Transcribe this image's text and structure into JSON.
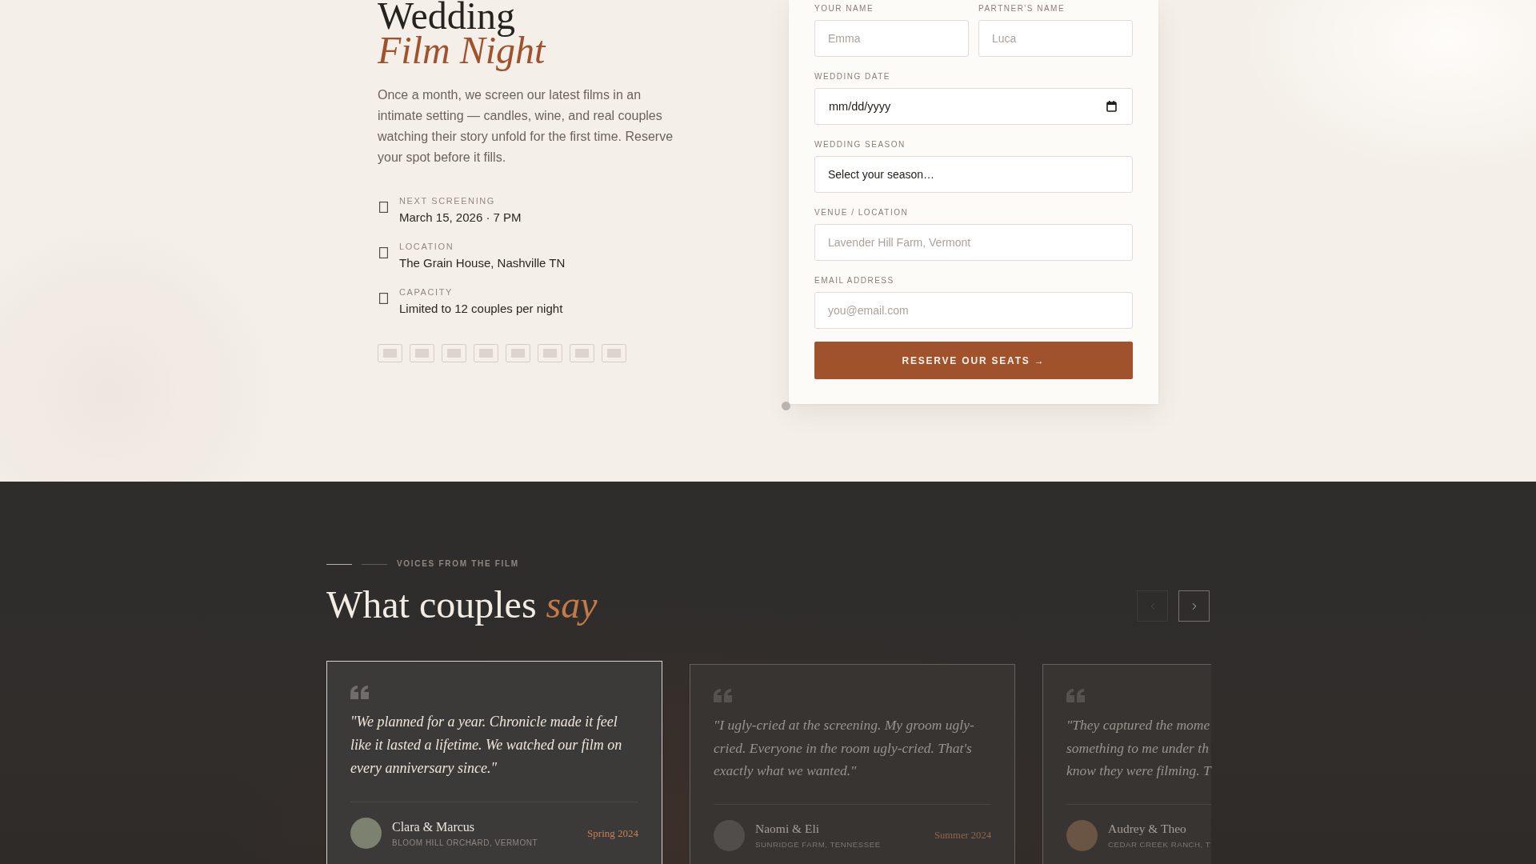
{
  "hero": {
    "title": "Wedding *Film Night*",
    "description": "Once a month, we screen our latest films in an intimate setting — candles, wine, and real couples watching their story unfold for the first time. Reserve your spot before it fills.",
    "details": [
      {
        "label": "NEXT SCREENING",
        "value": "March 15, 2026 · 7 PM"
      },
      {
        "label": "LOCATION",
        "value": "The Grain House, Nashville TN"
      },
      {
        "label": "CAPACITY",
        "value": "Limited to 12 couples per night"
      }
    ]
  },
  "form": {
    "rows": [
      [
        {
          "kind": "text",
          "label": "YOUR NAME",
          "placeholder": "Emma"
        },
        {
          "kind": "text",
          "label": "PARTNER'S NAME",
          "placeholder": "Luca"
        }
      ],
      [
        {
          "kind": "date",
          "label": "WEDDING DATE",
          "placeholder": "mm/dd/yyyy"
        }
      ],
      [
        {
          "kind": "select",
          "label": "WEDDING SEASON",
          "value": "Select your season…"
        }
      ],
      [
        {
          "kind": "text",
          "label": "VENUE / LOCATION",
          "placeholder": "Lavender Hill Farm, Vermont"
        }
      ],
      [
        {
          "kind": "email",
          "label": "EMAIL ADDRESS",
          "placeholder": "you@email.com"
        }
      ]
    ],
    "submit": "RESERVE OUR SEATS →"
  },
  "testimonials": {
    "eyebrow": "VOICES FROM THE FILM",
    "title": "What couples *say*",
    "nav": [
      {
        "kind": "prev",
        "disabled": true
      },
      {
        "kind": "next",
        "disabled": false
      }
    ],
    "cards": [
      {
        "selected": true,
        "quote": "\"We planned for a year. Chronicle made it feel like it lasted a lifetime. We watched our film on every anniversary since.\"",
        "name": "Clara & Marcus",
        "place": "BLOOM HILL ORCHARD, VERMONT",
        "season": "Spring 2024"
      },
      {
        "selected": false,
        "quote": "\"I ugly-cried at the screening. My groom ugly-cried. Everyone in the room ugly-cried. That's exactly what we wanted.\"",
        "name": "Naomi & Eli",
        "place": "SUNRIDGE FARM, TENNESSEE",
        "season": "Summer 2024"
      },
      {
        "selected": false,
        "quote": "\"They captured the mome\nsomething to me under th\nknow they were filming. T",
        "name": "Audrey & Theo",
        "place": "CEDAR CREEK RANCH, T"
      }
    ]
  }
}
